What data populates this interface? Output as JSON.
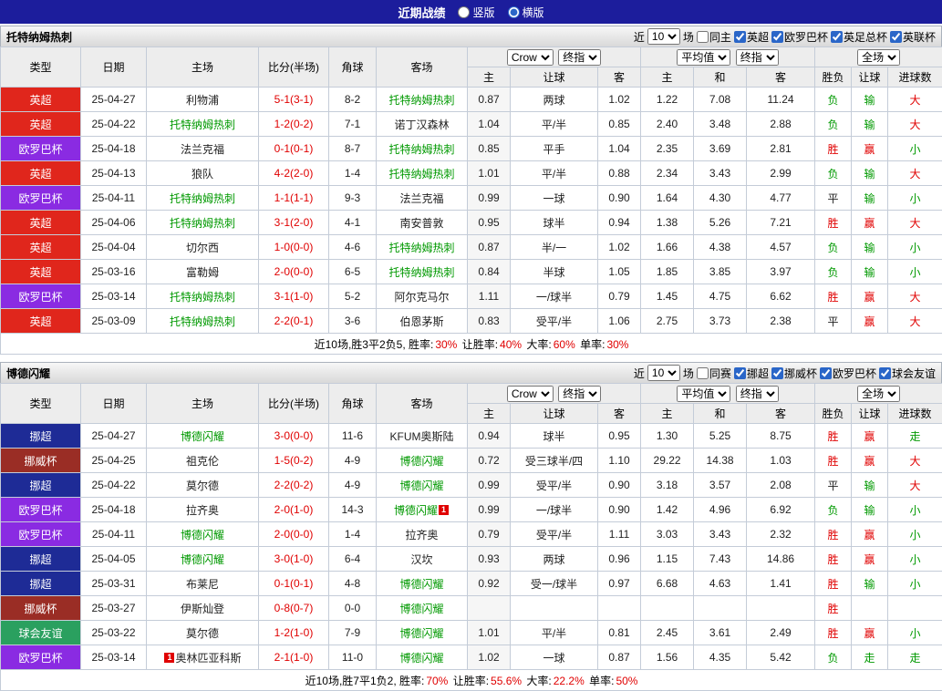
{
  "topbar": {
    "title": "近期战绩",
    "radio_vertical": "竖版",
    "radio_horizontal": "横版"
  },
  "selects": {
    "bookmaker": "Crow",
    "stage1": "终指",
    "average": "平均值",
    "stage2": "终指",
    "scope": "全场"
  },
  "columns": {
    "type": "类型",
    "date": "日期",
    "home": "主场",
    "score": "比分(半场)",
    "corner": "角球",
    "away": "客场",
    "odds_home": "主",
    "odds_handicap": "让球",
    "odds_away": "客",
    "avg_home": "主",
    "avg_draw": "和",
    "avg_away": "客",
    "result_wl": "胜负",
    "result_handicap": "让球",
    "result_goals": "进球数"
  },
  "colors": {
    "league": {
      "英超": "#e0261c",
      "欧罗巴杯": "#8a2be2",
      "挪超": "#1e2b96",
      "挪威杯": "#9a2d25",
      "球会友谊": "#2aa05f"
    },
    "result": {
      "red": "#e00000",
      "green": "#009900",
      "black": "#222222"
    },
    "team_green": "#009900",
    "score_red": "#e00000"
  },
  "sections": [
    {
      "team": "托特纳姆热刺",
      "filter": {
        "near": "近",
        "count": "10",
        "unit": "场",
        "same": "同主",
        "leagues": [
          "英超",
          "欧罗巴杯",
          "英足总杯",
          "英联杯"
        ]
      },
      "rows": [
        {
          "type": "英超",
          "date": "25-04-27",
          "home": "利物浦",
          "ht": false,
          "score": "5-1(3-1)",
          "corner": "8-2",
          "away": "托特纳姆热刺",
          "at": true,
          "o": [
            "0.87",
            "两球",
            "1.02"
          ],
          "avg": [
            "1.22",
            "7.08",
            "11.24"
          ],
          "res": [
            [
              "负",
              "g"
            ],
            [
              "输",
              "g"
            ],
            [
              "大",
              "r"
            ]
          ]
        },
        {
          "type": "英超",
          "date": "25-04-22",
          "home": "托特纳姆热刺",
          "ht": true,
          "score": "1-2(0-2)",
          "corner": "7-1",
          "away": "诺丁汉森林",
          "at": false,
          "o": [
            "1.04",
            "平/半",
            "0.85"
          ],
          "avg": [
            "2.40",
            "3.48",
            "2.88"
          ],
          "res": [
            [
              "负",
              "g"
            ],
            [
              "输",
              "g"
            ],
            [
              "大",
              "r"
            ]
          ]
        },
        {
          "type": "欧罗巴杯",
          "date": "25-04-18",
          "home": "法兰克福",
          "ht": false,
          "score": "0-1(0-1)",
          "corner": "8-7",
          "away": "托特纳姆热刺",
          "at": true,
          "o": [
            "0.85",
            "平手",
            "1.04"
          ],
          "avg": [
            "2.35",
            "3.69",
            "2.81"
          ],
          "res": [
            [
              "胜",
              "r"
            ],
            [
              "赢",
              "r"
            ],
            [
              "小",
              "g"
            ]
          ]
        },
        {
          "type": "英超",
          "date": "25-04-13",
          "home": "狼队",
          "ht": false,
          "score": "4-2(2-0)",
          "corner": "1-4",
          "away": "托特纳姆热刺",
          "at": true,
          "o": [
            "1.01",
            "平/半",
            "0.88"
          ],
          "avg": [
            "2.34",
            "3.43",
            "2.99"
          ],
          "res": [
            [
              "负",
              "g"
            ],
            [
              "输",
              "g"
            ],
            [
              "大",
              "r"
            ]
          ]
        },
        {
          "type": "欧罗巴杯",
          "date": "25-04-11",
          "home": "托特纳姆热刺",
          "ht": true,
          "score": "1-1(1-1)",
          "corner": "9-3",
          "away": "法兰克福",
          "at": false,
          "o": [
            "0.99",
            "一球",
            "0.90"
          ],
          "avg": [
            "1.64",
            "4.30",
            "4.77"
          ],
          "res": [
            [
              "平",
              "k"
            ],
            [
              "输",
              "g"
            ],
            [
              "小",
              "g"
            ]
          ]
        },
        {
          "type": "英超",
          "date": "25-04-06",
          "home": "托特纳姆热刺",
          "ht": true,
          "score": "3-1(2-0)",
          "corner": "4-1",
          "away": "南安普敦",
          "at": false,
          "o": [
            "0.95",
            "球半",
            "0.94"
          ],
          "avg": [
            "1.38",
            "5.26",
            "7.21"
          ],
          "res": [
            [
              "胜",
              "r"
            ],
            [
              "赢",
              "r"
            ],
            [
              "大",
              "r"
            ]
          ]
        },
        {
          "type": "英超",
          "date": "25-04-04",
          "home": "切尔西",
          "ht": false,
          "score": "1-0(0-0)",
          "corner": "4-6",
          "away": "托特纳姆热刺",
          "at": true,
          "o": [
            "0.87",
            "半/一",
            "1.02"
          ],
          "avg": [
            "1.66",
            "4.38",
            "4.57"
          ],
          "res": [
            [
              "负",
              "g"
            ],
            [
              "输",
              "g"
            ],
            [
              "小",
              "g"
            ]
          ]
        },
        {
          "type": "英超",
          "date": "25-03-16",
          "home": "富勒姆",
          "ht": false,
          "score": "2-0(0-0)",
          "corner": "6-5",
          "away": "托特纳姆热刺",
          "at": true,
          "o": [
            "0.84",
            "半球",
            "1.05"
          ],
          "avg": [
            "1.85",
            "3.85",
            "3.97"
          ],
          "res": [
            [
              "负",
              "g"
            ],
            [
              "输",
              "g"
            ],
            [
              "小",
              "g"
            ]
          ]
        },
        {
          "type": "欧罗巴杯",
          "date": "25-03-14",
          "home": "托特纳姆热刺",
          "ht": true,
          "score": "3-1(1-0)",
          "corner": "5-2",
          "away": "阿尔克马尔",
          "at": false,
          "o": [
            "1.11",
            "一/球半",
            "0.79"
          ],
          "avg": [
            "1.45",
            "4.75",
            "6.62"
          ],
          "res": [
            [
              "胜",
              "r"
            ],
            [
              "赢",
              "r"
            ],
            [
              "大",
              "r"
            ]
          ]
        },
        {
          "type": "英超",
          "date": "25-03-09",
          "home": "托特纳姆热刺",
          "ht": true,
          "score": "2-2(0-1)",
          "corner": "3-6",
          "away": "伯恩茅斯",
          "at": false,
          "o": [
            "0.83",
            "受平/半",
            "1.06"
          ],
          "avg": [
            "2.75",
            "3.73",
            "2.38"
          ],
          "res": [
            [
              "平",
              "k"
            ],
            [
              "赢",
              "r"
            ],
            [
              "大",
              "r"
            ]
          ]
        }
      ],
      "summary": [
        {
          "t": "近10场,胜3平2负5, 胜率:",
          "c": "k"
        },
        {
          "t": "30%",
          "c": "r"
        },
        {
          "t": " 让胜率:",
          "c": "k"
        },
        {
          "t": "40%",
          "c": "r"
        },
        {
          "t": " 大率:",
          "c": "k"
        },
        {
          "t": "60%",
          "c": "r"
        },
        {
          "t": " 单率:",
          "c": "k"
        },
        {
          "t": "30%",
          "c": "r"
        }
      ]
    },
    {
      "team": "博德闪耀",
      "filter": {
        "near": "近",
        "count": "10",
        "unit": "场",
        "same": "同赛",
        "leagues": [
          "挪超",
          "挪威杯",
          "欧罗巴杯",
          "球会友谊"
        ]
      },
      "rows": [
        {
          "type": "挪超",
          "date": "25-04-27",
          "home": "博德闪耀",
          "ht": true,
          "score": "3-0(0-0)",
          "corner": "11-6",
          "away": "KFUM奥斯陆",
          "at": false,
          "o": [
            "0.94",
            "球半",
            "0.95"
          ],
          "avg": [
            "1.30",
            "5.25",
            "8.75"
          ],
          "res": [
            [
              "胜",
              "r"
            ],
            [
              "赢",
              "r"
            ],
            [
              "走",
              "g"
            ]
          ]
        },
        {
          "type": "挪威杯",
          "date": "25-04-25",
          "home": "祖克伦",
          "ht": false,
          "score": "1-5(0-2)",
          "corner": "4-9",
          "away": "博德闪耀",
          "at": true,
          "o": [
            "0.72",
            "受三球半/四",
            "1.10"
          ],
          "avg": [
            "29.22",
            "14.38",
            "1.03"
          ],
          "res": [
            [
              "胜",
              "r"
            ],
            [
              "赢",
              "r"
            ],
            [
              "大",
              "r"
            ]
          ]
        },
        {
          "type": "挪超",
          "date": "25-04-22",
          "home": "莫尔德",
          "ht": false,
          "score": "2-2(0-2)",
          "corner": "4-9",
          "away": "博德闪耀",
          "at": true,
          "o": [
            "0.99",
            "受平/半",
            "0.90"
          ],
          "avg": [
            "3.18",
            "3.57",
            "2.08"
          ],
          "res": [
            [
              "平",
              "k"
            ],
            [
              "输",
              "g"
            ],
            [
              "大",
              "r"
            ]
          ]
        },
        {
          "type": "欧罗巴杯",
          "date": "25-04-18",
          "home": "拉齐奥",
          "ht": false,
          "score": "2-0(1-0)",
          "corner": "14-3",
          "away": "博德闪耀",
          "at": true,
          "ab_after": "1",
          "o": [
            "0.99",
            "一/球半",
            "0.90"
          ],
          "avg": [
            "1.42",
            "4.96",
            "6.92"
          ],
          "res": [
            [
              "负",
              "g"
            ],
            [
              "输",
              "g"
            ],
            [
              "小",
              "g"
            ]
          ]
        },
        {
          "type": "欧罗巴杯",
          "date": "25-04-11",
          "home": "博德闪耀",
          "ht": true,
          "score": "2-0(0-0)",
          "corner": "1-4",
          "away": "拉齐奥",
          "at": false,
          "o": [
            "0.79",
            "受平/半",
            "1.11"
          ],
          "avg": [
            "3.03",
            "3.43",
            "2.32"
          ],
          "res": [
            [
              "胜",
              "r"
            ],
            [
              "赢",
              "r"
            ],
            [
              "小",
              "g"
            ]
          ]
        },
        {
          "type": "挪超",
          "date": "25-04-05",
          "home": "博德闪耀",
          "ht": true,
          "score": "3-0(1-0)",
          "corner": "6-4",
          "away": "汉坎",
          "at": false,
          "o": [
            "0.93",
            "两球",
            "0.96"
          ],
          "avg": [
            "1.15",
            "7.43",
            "14.86"
          ],
          "res": [
            [
              "胜",
              "r"
            ],
            [
              "赢",
              "r"
            ],
            [
              "小",
              "g"
            ]
          ]
        },
        {
          "type": "挪超",
          "date": "25-03-31",
          "home": "布莱尼",
          "ht": false,
          "score": "0-1(0-1)",
          "corner": "4-8",
          "away": "博德闪耀",
          "at": true,
          "o": [
            "0.92",
            "受一/球半",
            "0.97"
          ],
          "avg": [
            "6.68",
            "4.63",
            "1.41"
          ],
          "res": [
            [
              "胜",
              "r"
            ],
            [
              "输",
              "g"
            ],
            [
              "小",
              "g"
            ]
          ]
        },
        {
          "type": "挪威杯",
          "date": "25-03-27",
          "home": "伊斯灿登",
          "ht": false,
          "score": "0-8(0-7)",
          "corner": "0-0",
          "away": "博德闪耀",
          "at": true,
          "o": [
            "",
            "",
            ""
          ],
          "avg": [
            "",
            "",
            ""
          ],
          "res": [
            [
              "胜",
              "r"
            ],
            [
              "",
              "k"
            ],
            [
              "",
              "k"
            ]
          ]
        },
        {
          "type": "球会友谊",
          "date": "25-03-22",
          "home": "莫尔德",
          "ht": false,
          "score": "1-2(1-0)",
          "corner": "7-9",
          "away": "博德闪耀",
          "at": true,
          "o": [
            "1.01",
            "平/半",
            "0.81"
          ],
          "avg": [
            "2.45",
            "3.61",
            "2.49"
          ],
          "res": [
            [
              "胜",
              "r"
            ],
            [
              "赢",
              "r"
            ],
            [
              "小",
              "g"
            ]
          ]
        },
        {
          "type": "欧罗巴杯",
          "date": "25-03-14",
          "home": "奥林匹亚科斯",
          "ht": false,
          "hb_before": "1",
          "score": "2-1(1-0)",
          "corner": "11-0",
          "away": "博德闪耀",
          "at": true,
          "o": [
            "1.02",
            "一球",
            "0.87"
          ],
          "avg": [
            "1.56",
            "4.35",
            "5.42"
          ],
          "res": [
            [
              "负",
              "g"
            ],
            [
              "走",
              "g"
            ],
            [
              "走",
              "g"
            ]
          ]
        }
      ],
      "summary": [
        {
          "t": "近10场,胜7平1负2, 胜率:",
          "c": "k"
        },
        {
          "t": "70%",
          "c": "r"
        },
        {
          "t": " 让胜率:",
          "c": "k"
        },
        {
          "t": "55.6%",
          "c": "r"
        },
        {
          "t": " 大率:",
          "c": "k"
        },
        {
          "t": "22.2%",
          "c": "r"
        },
        {
          "t": " 单率:",
          "c": "k"
        },
        {
          "t": "50%",
          "c": "r"
        }
      ]
    }
  ]
}
